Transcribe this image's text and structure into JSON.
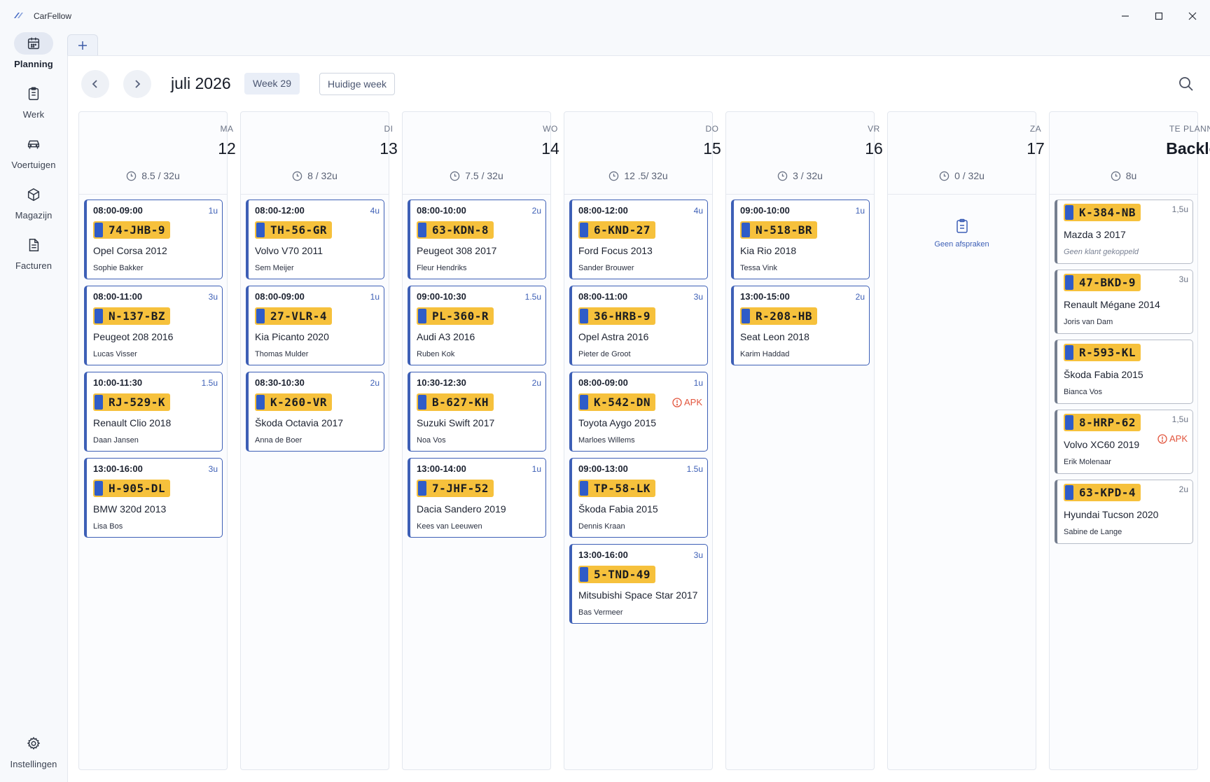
{
  "app": {
    "title": "CarFellow"
  },
  "sidebar": {
    "items": [
      {
        "label": "Planning",
        "icon": "calendar-icon"
      },
      {
        "label": "Werk",
        "icon": "clipboard-icon"
      },
      {
        "label": "Voertuigen",
        "icon": "car-icon"
      },
      {
        "label": "Magazijn",
        "icon": "box-icon"
      },
      {
        "label": "Facturen",
        "icon": "document-icon"
      }
    ],
    "settings": {
      "label": "Instellingen",
      "icon": "gear-icon"
    }
  },
  "toolbar": {
    "month": "juli 2026",
    "week": "Week 29",
    "today_label": "Huidige week"
  },
  "days": [
    {
      "day": "MA",
      "num": "12",
      "hours": "8.5 / 32u",
      "cards": [
        {
          "time": "08:00-09:00",
          "dur": "1u",
          "plate": "74-JHB-9",
          "car": "Opel Corsa 2012",
          "client": "Sophie Bakker"
        },
        {
          "time": "08:00-11:00",
          "dur": "3u",
          "plate": "N-137-BZ",
          "car": "Peugeot 208 2016",
          "client": "Lucas Visser"
        },
        {
          "time": "10:00-11:30",
          "dur": "1.5u",
          "plate": "RJ-529-K",
          "car": "Renault Clio 2018",
          "client": "Daan Jansen"
        },
        {
          "time": "13:00-16:00",
          "dur": "3u",
          "plate": "H-905-DL",
          "car": "BMW 320d 2013",
          "client": "Lisa Bos"
        }
      ]
    },
    {
      "day": "DI",
      "num": "13",
      "hours": "8 / 32u",
      "cards": [
        {
          "time": "08:00-12:00",
          "dur": "4u",
          "plate": "TH-56-GR",
          "car": "Volvo V70 2011",
          "client": "Sem Meijer"
        },
        {
          "time": "08:00-09:00",
          "dur": "1u",
          "plate": "27-VLR-4",
          "car": "Kia Picanto 2020",
          "client": "Thomas Mulder"
        },
        {
          "time": "08:30-10:30",
          "dur": "2u",
          "plate": "K-260-VR",
          "car": "Škoda Octavia 2017",
          "client": "Anna de Boer"
        }
      ]
    },
    {
      "day": "WO",
      "num": "14",
      "hours": "7.5 / 32u",
      "cards": [
        {
          "time": "08:00-10:00",
          "dur": "2u",
          "plate": "63-KDN-8",
          "car": "Peugeot 308 2017",
          "client": "Fleur Hendriks"
        },
        {
          "time": "09:00-10:30",
          "dur": "1.5u",
          "plate": "PL-360-R",
          "car": "Audi A3 2016",
          "client": "Ruben Kok"
        },
        {
          "time": "10:30-12:30",
          "dur": "2u",
          "plate": "B-627-KH",
          "car": "Suzuki Swift 2017",
          "client": "Noa Vos"
        },
        {
          "time": "13:00-14:00",
          "dur": "1u",
          "plate": "7-JHF-52",
          "car": "Dacia Sandero 2019",
          "client": "Kees van Leeuwen"
        }
      ]
    },
    {
      "day": "DO",
      "num": "15",
      "hours": "12 .5/ 32u",
      "cards": [
        {
          "time": "08:00-12:00",
          "dur": "4u",
          "plate": "6-KND-27",
          "car": "Ford Focus 2013",
          "client": "Sander Brouwer"
        },
        {
          "time": "08:00-11:00",
          "dur": "3u",
          "plate": "36-HRB-9",
          "car": "Opel Astra 2016",
          "client": "Pieter de Groot"
        },
        {
          "time": "08:00-09:00",
          "dur": "1u",
          "plate": "K-542-DN",
          "car": "Toyota Aygo 2015",
          "client": "Marloes Willems",
          "apk": "APK"
        },
        {
          "time": "09:00-13:00",
          "dur": "1.5u",
          "plate": "TP-58-LK",
          "car": "Škoda Fabia 2015",
          "client": "Dennis Kraan"
        },
        {
          "time": "13:00-16:00",
          "dur": "3u",
          "plate": "5-TND-49",
          "car": "Mitsubishi Space Star 2017",
          "client": "Bas Vermeer"
        }
      ]
    },
    {
      "day": "VR",
      "num": "16",
      "hours": "3 / 32u",
      "cards": [
        {
          "time": "09:00-10:00",
          "dur": "1u",
          "plate": "N-518-BR",
          "car": "Kia Rio 2018",
          "client": "Tessa Vink"
        },
        {
          "time": "13:00-15:00",
          "dur": "2u",
          "plate": "R-208-HB",
          "car": "Seat Leon 2018",
          "client": "Karim Haddad"
        }
      ]
    },
    {
      "day": "ZA",
      "num": "17",
      "hours": "0 / 32u",
      "cards": [],
      "empty": "Geen afspraken"
    }
  ],
  "backlog": {
    "day": "TE PLANNEN",
    "title": "Backlog",
    "hours": "8u",
    "cards": [
      {
        "dur": "1,5u",
        "plate": "K-384-NB",
        "car": "Mazda 3 2017",
        "client": "Geen klant gekoppeld",
        "no_client": true
      },
      {
        "dur": "3u",
        "plate": "47-BKD-9",
        "car": "Renault Mégane 2014",
        "client": "Joris van Dam"
      },
      {
        "dur": "",
        "plate": "R-593-KL",
        "car": "Škoda Fabia 2015",
        "client": "Bianca Vos"
      },
      {
        "dur": "1,5u",
        "plate": "8-HRP-62",
        "car": "Volvo XC60 2019",
        "client": "Erik Molenaar",
        "apk": "APK"
      },
      {
        "dur": "2u",
        "plate": "63-KPD-4",
        "car": "Hyundai Tucson 2020",
        "client": "Sabine de Lange"
      }
    ]
  },
  "colors": {
    "accent": "#3d5fb6",
    "plate_yellow": "#f6c13c",
    "plate_blue": "#2f5cc8",
    "warning": "#e2553d"
  }
}
